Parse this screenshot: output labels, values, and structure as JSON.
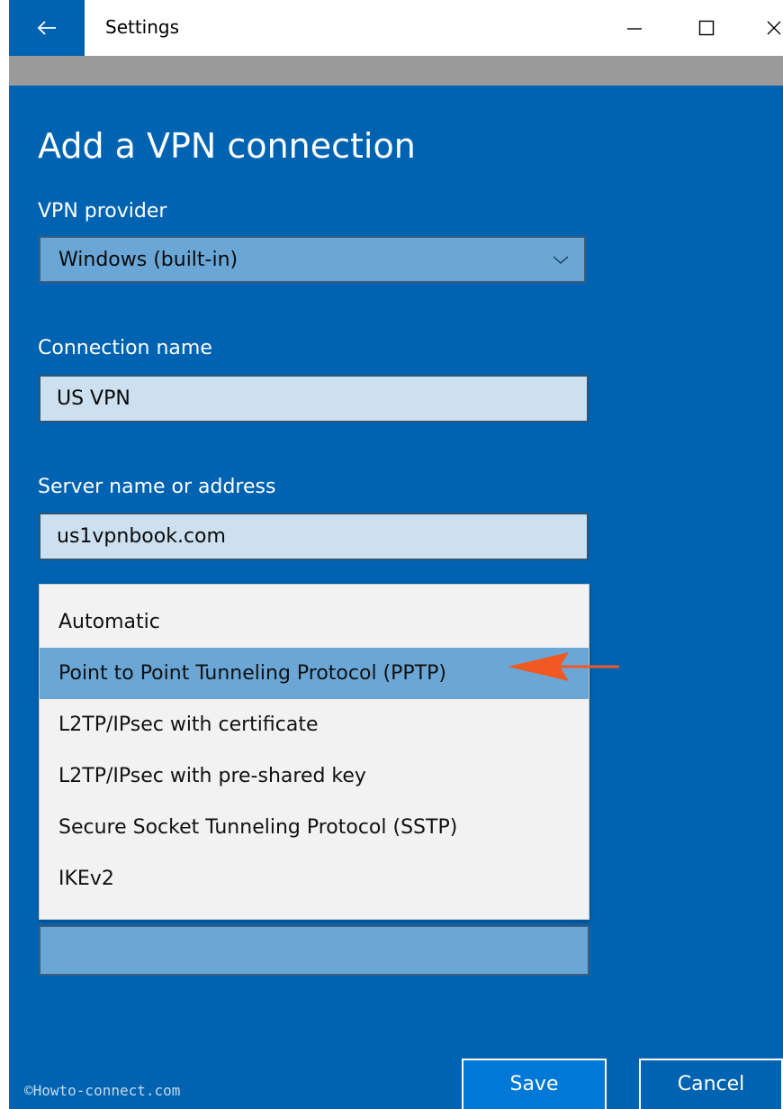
{
  "window": {
    "title": "Settings",
    "back_icon": "arrow-left-icon",
    "minimize_icon": "minimize-icon",
    "maximize_icon": "maximize-icon",
    "close_icon": "close-icon"
  },
  "colors": {
    "accent": "#0063b1",
    "field_blue": "#6aa7d6",
    "textbox_bg": "#cce0f0",
    "annotation_arrow": "#f05a22"
  },
  "page": {
    "title": "Add a VPN connection"
  },
  "vpn_provider": {
    "label": "VPN provider",
    "value": "Windows (built-in)"
  },
  "connection_name": {
    "label": "Connection name",
    "value": "US VPN"
  },
  "server": {
    "label": "Server name or address",
    "value": "us1vpnbook.com"
  },
  "vpn_type_dropdown": {
    "options": [
      "Automatic",
      "Point to Point Tunneling Protocol (PPTP)",
      "L2TP/IPsec with certificate",
      "L2TP/IPsec with pre-shared key",
      "Secure Socket Tunneling Protocol (SSTP)",
      "IKEv2"
    ],
    "selected_index": 1
  },
  "footer": {
    "watermark": "©Howto-connect.com",
    "save_label": "Save",
    "cancel_label": "Cancel"
  }
}
